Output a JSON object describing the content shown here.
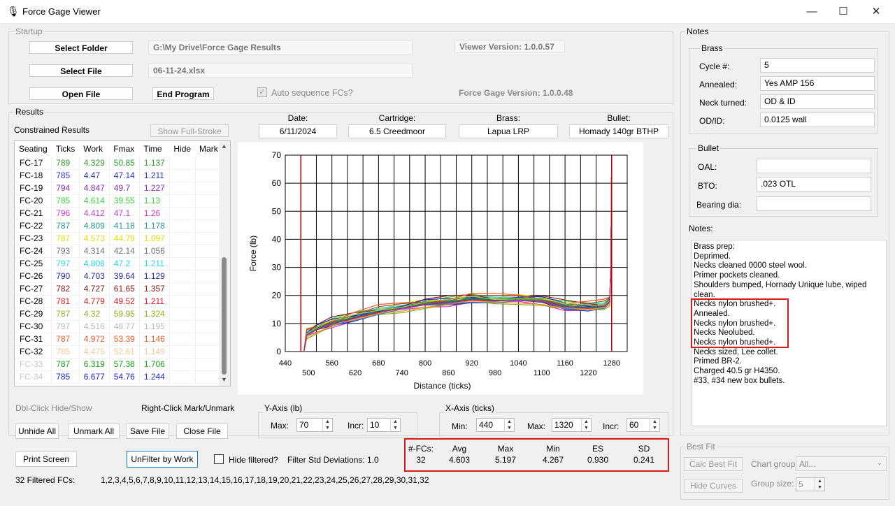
{
  "window": {
    "title": "Force Gage Viewer",
    "minimize": "—",
    "maximize": "☐",
    "close": "✕"
  },
  "startup": {
    "label": "Startup",
    "select_folder": "Select Folder",
    "select_file": "Select File",
    "open_file": "Open File",
    "end_program": "End Program",
    "folder_path": "G:\\My Drive\\Force Gage Results",
    "file_name": "06-11-24.xlsx",
    "viewer_version": "Viewer Version: 1.0.0.57",
    "gage_version": "Force Gage Version: 1.0.0.48",
    "auto_sequence": "Auto sequence FCs?"
  },
  "results": {
    "label": "Results",
    "constrained": "Constrained Results",
    "show_full_stroke": "Show Full-Stroke",
    "columns": [
      "Seating",
      "Ticks",
      "Work",
      "Fmax",
      "Time",
      "Hide",
      "Mark"
    ],
    "rows": [
      {
        "id": "FC-17",
        "ticks": "789",
        "work": "4.329",
        "fmax": "50.85",
        "time": "1.137",
        "color": "#2e9e2e"
      },
      {
        "id": "FC-18",
        "ticks": "785",
        "work": "4.47",
        "fmax": "47.14",
        "time": "1.211",
        "color": "#2a36c8"
      },
      {
        "id": "FC-19",
        "ticks": "794",
        "work": "4.847",
        "fmax": "49.7",
        "time": "1.227",
        "color": "#8a2ab0"
      },
      {
        "id": "FC-20",
        "ticks": "785",
        "work": "4.614",
        "fmax": "39.55",
        "time": "1.13",
        "color": "#3ad63a"
      },
      {
        "id": "FC-21",
        "ticks": "796",
        "work": "4.412",
        "fmax": "47.1",
        "time": "1.26",
        "color": "#d23ad2"
      },
      {
        "id": "FC-22",
        "ticks": "787",
        "work": "4.809",
        "fmax": "41.18",
        "time": "1.178",
        "color": "#239a8c"
      },
      {
        "id": "FC-23",
        "ticks": "787",
        "work": "4.573",
        "fmax": "44.79",
        "time": "1.097",
        "color": "#e0e000"
      },
      {
        "id": "FC-24",
        "ticks": "793",
        "work": "4.314",
        "fmax": "42.14",
        "time": "1.056",
        "color": "#707070"
      },
      {
        "id": "FC-25",
        "ticks": "797",
        "work": "4.808",
        "fmax": "47.2",
        "time": "1.211",
        "color": "#28d6e8"
      },
      {
        "id": "FC-26",
        "ticks": "790",
        "work": "4.703",
        "fmax": "39.64",
        "time": "1.129",
        "color": "#262aa0"
      },
      {
        "id": "FC-27",
        "ticks": "782",
        "work": "4.727",
        "fmax": "61.65",
        "time": "1.357",
        "color": "#8a1a1a"
      },
      {
        "id": "FC-28",
        "ticks": "781",
        "work": "4.779",
        "fmax": "49.52",
        "time": "1.211",
        "color": "#e01e1e"
      },
      {
        "id": "FC-29",
        "ticks": "787",
        "work": "4.32",
        "fmax": "59.95",
        "time": "1.324",
        "color": "#8ab020"
      },
      {
        "id": "FC-30",
        "ticks": "797",
        "work": "4.516",
        "fmax": "48.77",
        "time": "1.195",
        "color": "#b8b8b8"
      },
      {
        "id": "FC-31",
        "ticks": "787",
        "work": "4.972",
        "fmax": "53.39",
        "time": "1.146",
        "color": "#f05a28"
      },
      {
        "id": "FC-32",
        "ticks": "785",
        "work": "4.475",
        "fmax": "52.61",
        "time": "1.149",
        "color": "#f5c896"
      },
      {
        "id": "FC-33",
        "ticks": "787",
        "work": "6.319",
        "fmax": "57.38",
        "time": "1.706",
        "color": "#15a015",
        "idcolor": "#c8c8c8"
      },
      {
        "id": "FC-34",
        "ticks": "785",
        "work": "6.677",
        "fmax": "54.76",
        "time": "1.244",
        "color": "#1e28d2",
        "idcolor": "#c8c8c8"
      }
    ],
    "dbl_click": "Dbl-Click Hide/Show",
    "right_click": "Right-Click Mark/Unmark",
    "unhide_all": "Unhide All",
    "unmark_all": "Unmark All",
    "save_file": "Save File",
    "close_file": "Close File"
  },
  "info": {
    "date_label": "Date:",
    "date": "6/11/2024",
    "cartridge_label": "Cartridge:",
    "cartridge": "6.5 Creedmoor",
    "brass_label": "Brass:",
    "brass": "Lapua LRP",
    "bullet_label": "Bullet:",
    "bullet": "Homady 140gr BTHP"
  },
  "chart_data": {
    "type": "line",
    "xlabel": "Distance (ticks)",
    "ylabel": "Force (lb)",
    "xlim": [
      440,
      1320
    ],
    "ylim": [
      0,
      70
    ],
    "x_ticks_upper": [
      "440",
      "560",
      "680",
      "800",
      "920",
      "1040",
      "1160",
      "1280"
    ],
    "x_ticks_lower": [
      "500",
      "620",
      "740",
      "860",
      "980",
      "1100",
      "1220"
    ],
    "y_ticks": [
      "0",
      "10",
      "20",
      "30",
      "40",
      "50",
      "60",
      "70"
    ],
    "grid": true,
    "markers_x": [
      480,
      1280
    ],
    "marker_color": "#c00000",
    "base_curve": [
      [
        488,
        0
      ],
      [
        495,
        6
      ],
      [
        520,
        8
      ],
      [
        560,
        10
      ],
      [
        620,
        12
      ],
      [
        680,
        14
      ],
      [
        740,
        15.5
      ],
      [
        800,
        17
      ],
      [
        860,
        17.5
      ],
      [
        920,
        18.5
      ],
      [
        980,
        18
      ],
      [
        1040,
        18.5
      ],
      [
        1100,
        18
      ],
      [
        1160,
        16
      ],
      [
        1220,
        15.5
      ],
      [
        1260,
        16
      ],
      [
        1275,
        18
      ],
      [
        1278,
        30
      ],
      [
        1280,
        70
      ]
    ],
    "series_colors": [
      "#2e9e2e",
      "#2a36c8",
      "#8a2ab0",
      "#3ad63a",
      "#d23ad2",
      "#239a8c",
      "#e0e000",
      "#707070",
      "#28d6e8",
      "#262aa0",
      "#8a1a1a",
      "#e01e1e",
      "#8ab020",
      "#b8b8b8",
      "#f05a28",
      "#f5c896",
      "#15a015",
      "#1e28d2",
      "#ff8c00",
      "#008080",
      "#a0522d",
      "#4682b4",
      "#9acd32",
      "#c71585"
    ],
    "series_offsets": [
      0.5,
      1.2,
      -0.8,
      2.1,
      -1.5,
      0.9,
      1.8,
      -0.3,
      1.5,
      -1.1,
      2.4,
      0.2,
      -1.8,
      1.0,
      2.8,
      -0.6,
      0.4,
      1.6,
      -1.3,
      0.7,
      2.0,
      -0.9,
      1.3,
      -0.2
    ]
  },
  "yaxis": {
    "label": "Y-Axis (lb)",
    "max_label": "Max:",
    "max": "70",
    "incr_label": "Incr:",
    "incr": "10"
  },
  "xaxis": {
    "label": "X-Axis (ticks)",
    "min_label": "Min:",
    "min": "440",
    "max_label": "Max:",
    "max": "1320",
    "incr_label": "Incr:",
    "incr": "60"
  },
  "stats": {
    "headers": [
      "#-FCs:",
      "Avg",
      "Max",
      "Min",
      "ES",
      "SD"
    ],
    "values": [
      "32",
      "4.603",
      "5.197",
      "4.267",
      "0.930",
      "0.241"
    ]
  },
  "filter": {
    "print_screen": "Print Screen",
    "unfilter": "UnFilter by Work",
    "hide_filtered": "Hide filtered?",
    "std_dev": "Filter Std Deviations: 1.0",
    "filtered_label": "32 Filtered FCs:",
    "filtered_list": "1,2,3,4,5,6,7,8,9,10,11,12,13,14,15,16,17,18,19,20,21,22,23,24,25,26,27,28,29,30,31,32"
  },
  "notes": {
    "label": "Notes",
    "brass_label": "Brass",
    "cycle_label": "Cycle #:",
    "cycle": "5",
    "annealed_label": "Annealed:",
    "annealed": "Yes AMP 156",
    "neck_turned_label": "Neck turned:",
    "neck_turned": "OD & ID",
    "odid_label": "OD/ID:",
    "odid": "0.0125 wall",
    "bullet_label": "Bullet",
    "oal_label": "OAL:",
    "oal": "",
    "bto_label": "BTO:",
    "bto": ".023 OTL",
    "bearing_label": "Bearing dia:",
    "bearing": "",
    "notes_label": "Notes:",
    "lines": [
      "Brass prep:",
      "Deprimed.",
      "Necks cleaned 0000 steel wool.",
      "Primer pockets cleaned.",
      "Shoulders bumped, Hornady Unique lube, wiped",
      "clean.",
      "Necks nylon brushed+.",
      "Annealed.",
      "Necks nylon brushed+.",
      "Necks Neolubed.",
      "Necks nylon brushed+.",
      "Necks sized, Lee collet.",
      "Primed BR-2.",
      "Charged 40.5 gr H4350.",
      "#33, #34 new box bullets."
    ]
  },
  "bestfit": {
    "label": "Best Fit",
    "calc": "Calc Best Fit",
    "hide_curves": "Hide Curves",
    "chart_group_label": "Chart group:",
    "chart_group": "All...",
    "group_size_label": "Group size:",
    "group_size": "5"
  }
}
